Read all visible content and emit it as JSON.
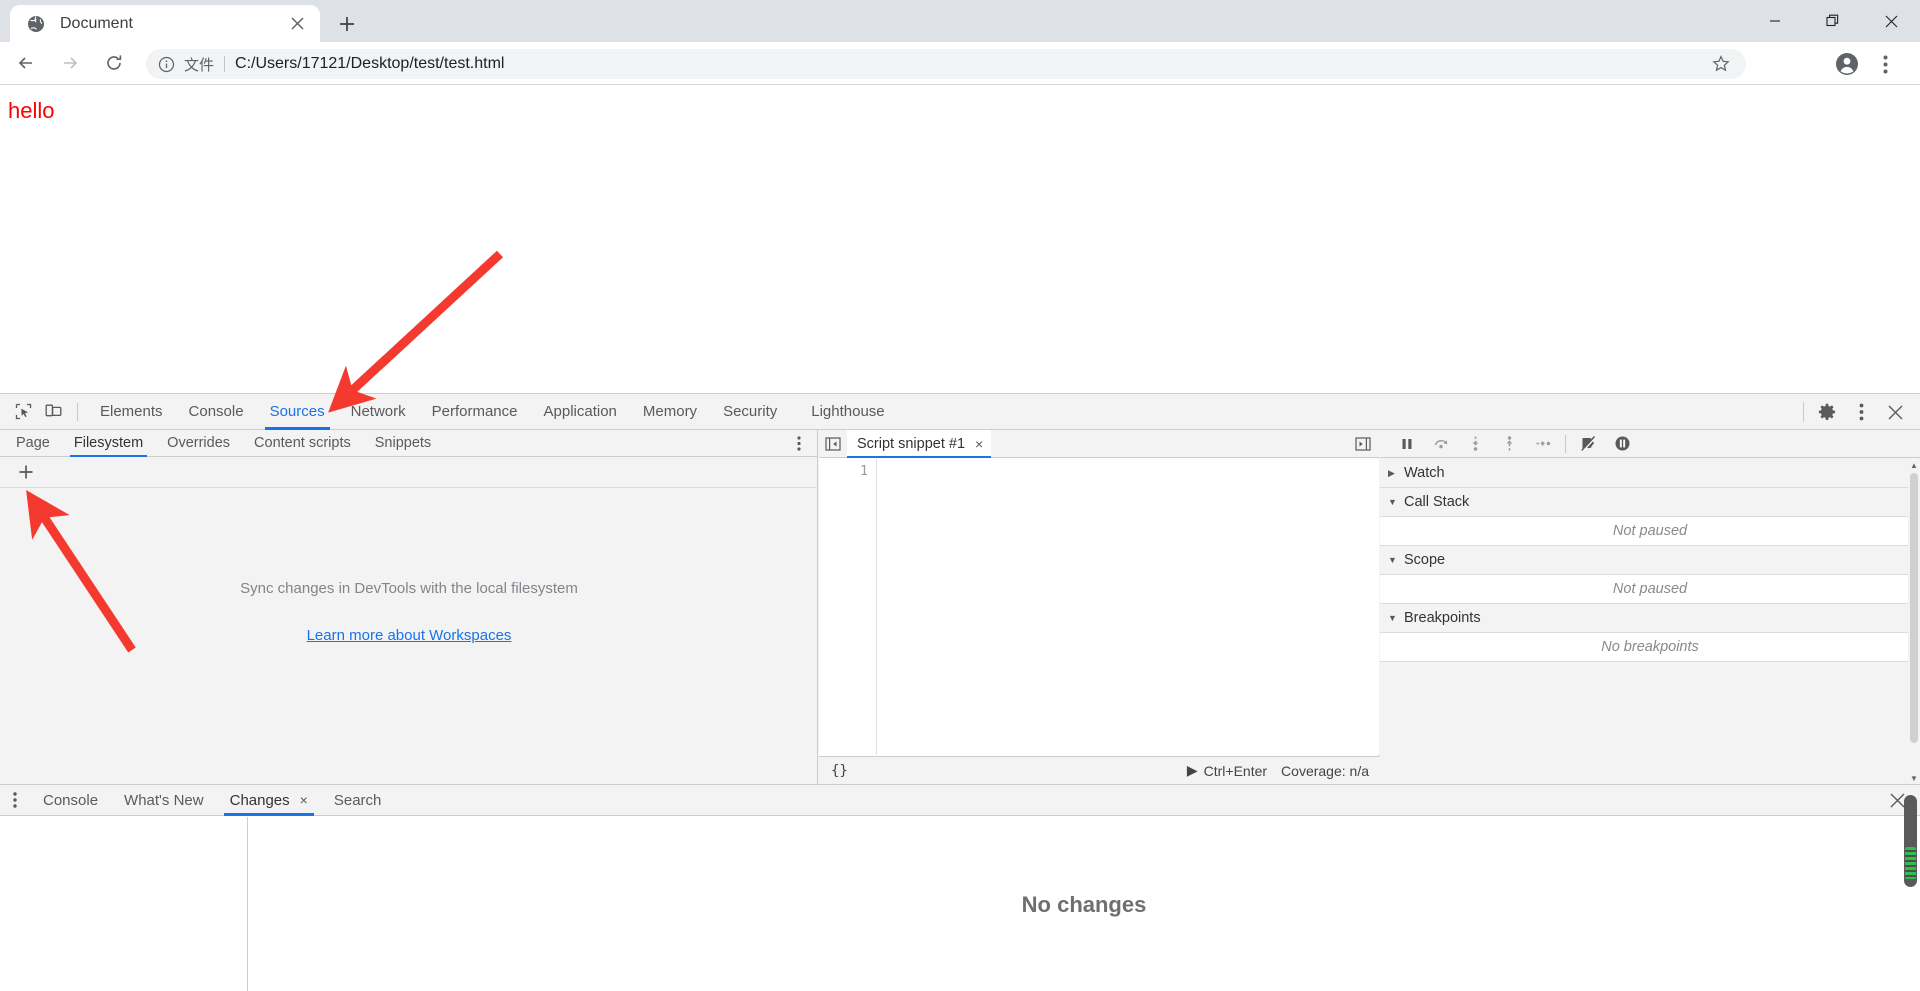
{
  "browser": {
    "tab": {
      "title": "Document",
      "favicon": "globe-icon",
      "close": "×"
    },
    "new_tab": "+",
    "window_controls": {
      "minimize": "—",
      "maximize": "❐",
      "close": "✕"
    },
    "nav": {
      "back": "←",
      "forward": "→",
      "reload": "⟳"
    },
    "omnibox": {
      "info_icon": "info-circle-icon",
      "scheme_label": "文件",
      "url": "C:/Users/17121/Desktop/test/test.html",
      "bookmark_icon": "star-icon",
      "profile_icon": "avatar-icon",
      "menu_icon": "three-dot-menu-icon"
    }
  },
  "page": {
    "text": "hello",
    "color": "#ff0000"
  },
  "devtools": {
    "left_icons": [
      {
        "name": "inspect-element-icon"
      },
      {
        "name": "device-toolbar-icon"
      }
    ],
    "main_tabs": [
      {
        "label": "Elements",
        "active": false
      },
      {
        "label": "Console",
        "active": false
      },
      {
        "label": "Sources",
        "active": true
      },
      {
        "label": "Network",
        "active": false
      },
      {
        "label": "Performance",
        "active": false
      },
      {
        "label": "Application",
        "active": false
      },
      {
        "label": "Memory",
        "active": false
      },
      {
        "label": "Security",
        "active": false
      },
      {
        "label": "Lighthouse",
        "active": false
      }
    ],
    "toolbar_right": [
      {
        "name": "settings-gear-icon"
      },
      {
        "name": "more-options-icon"
      },
      {
        "name": "close-devtools-icon"
      }
    ],
    "navigator": {
      "subtabs": [
        {
          "label": "Page",
          "active": false
        },
        {
          "label": "Filesystem",
          "active": true
        },
        {
          "label": "Overrides",
          "active": false
        },
        {
          "label": "Content scripts",
          "active": false
        },
        {
          "label": "Snippets",
          "active": false
        }
      ],
      "more_icon": "more-options-icon",
      "add_folder_icon": "plus-icon",
      "empty_message": "Sync changes in DevTools with the local filesystem",
      "empty_link": "Learn more about Workspaces"
    },
    "editor": {
      "collapse_left_icon": "collapse-navigator-icon",
      "expand_right_icon": "expand-debugger-icon",
      "file_tab": {
        "label": "Script snippet #1",
        "close": "×"
      },
      "line_numbers": [
        "1"
      ],
      "code_lines": [
        ""
      ],
      "status": {
        "format_icon": "{}",
        "run_icon": "▶",
        "run_shortcut": "Ctrl+Enter",
        "coverage": "Coverage: n/a"
      }
    },
    "debugger": {
      "buttons": [
        {
          "name": "pause-resume-icon"
        },
        {
          "name": "step-over-icon"
        },
        {
          "name": "step-into-icon"
        },
        {
          "name": "step-out-icon"
        },
        {
          "name": "step-icon"
        },
        {
          "name": "deactivate-breakpoints-icon"
        },
        {
          "name": "pause-on-exceptions-icon"
        }
      ],
      "sections": [
        {
          "title": "Watch",
          "expanded": false,
          "empty": null
        },
        {
          "title": "Call Stack",
          "expanded": true,
          "empty": "Not paused"
        },
        {
          "title": "Scope",
          "expanded": true,
          "empty": "Not paused"
        },
        {
          "title": "Breakpoints",
          "expanded": true,
          "empty": "No breakpoints"
        }
      ],
      "caret_expanded": "▼",
      "caret_collapsed": "▶"
    },
    "drawer": {
      "more_icon": "more-options-icon",
      "tabs": [
        {
          "label": "Console",
          "active": false,
          "closable": false
        },
        {
          "label": "What's New",
          "active": false,
          "closable": false
        },
        {
          "label": "Changes",
          "active": true,
          "closable": true
        },
        {
          "label": "Search",
          "active": false,
          "closable": false
        }
      ],
      "close_label": "✕",
      "changes_empty": "No changes"
    }
  },
  "annotations": [
    {
      "name": "arrow-to-sources-tab",
      "color": "#f4392f"
    },
    {
      "name": "arrow-to-add-folder-button",
      "color": "#f4392f"
    }
  ],
  "colors": {
    "accent": "#1a73e8",
    "annotation": "#f4392f",
    "page_text": "#ff0000",
    "chrome_tabstrip": "#dee1e6",
    "devtools_bg": "#f3f3f3"
  }
}
